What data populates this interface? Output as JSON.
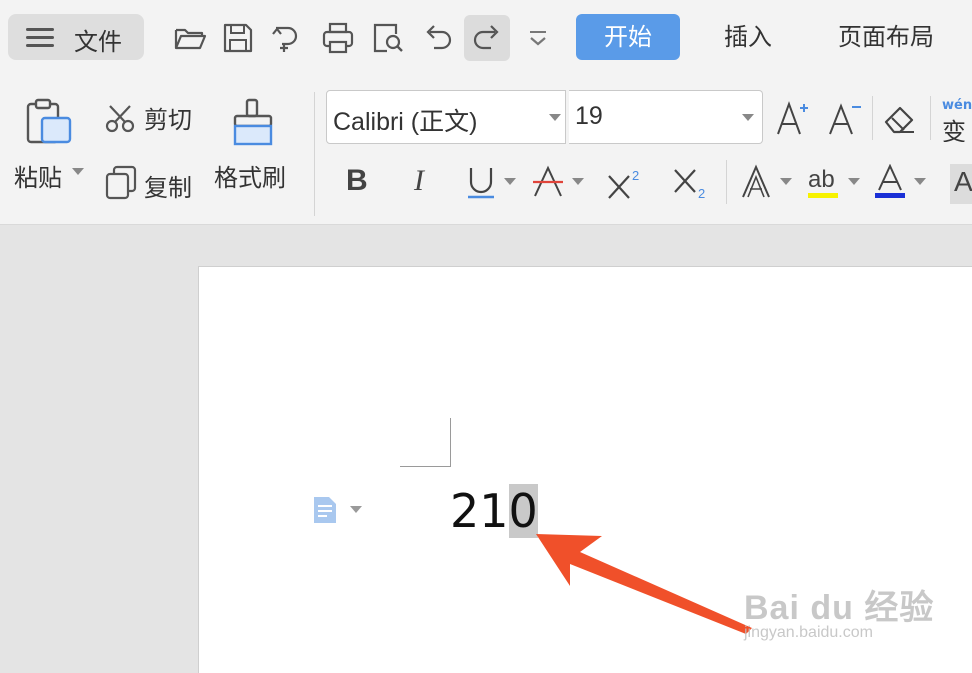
{
  "toolbar": {
    "file_label": "文件",
    "quick_icons": [
      "open-folder-icon",
      "save-icon",
      "export-icon",
      "print-icon",
      "print-preview-icon",
      "undo-icon",
      "redo-icon",
      "more-chevron-icon"
    ]
  },
  "tabs": [
    {
      "label": "开始",
      "active": true
    },
    {
      "label": "插入",
      "active": false
    },
    {
      "label": "页面布局",
      "active": false
    }
  ],
  "ribbon": {
    "paste_label": "粘贴",
    "cut_label": "剪切",
    "copy_label": "复制",
    "format_painter_label": "格式刷",
    "font_name": "Calibri (正文)",
    "font_size": "19",
    "pinyin_label": "wén",
    "pinyin_char": "变",
    "colors": {
      "accent": "#5a9be8",
      "highlight": "#f7f200",
      "font_color": "#1a2fd6",
      "strike_red": "#e0443a"
    }
  },
  "document": {
    "text_unselected": "21",
    "text_selected": "0"
  },
  "watermark": {
    "line1": "Bai du 经验",
    "line2": "jingyan.baidu.com"
  },
  "annotation": {
    "arrow_color": "#f0502a"
  }
}
